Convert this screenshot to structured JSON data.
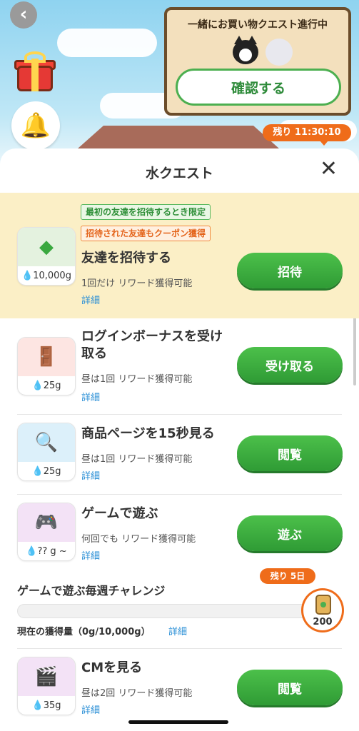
{
  "header": {
    "back_glyph": "‹",
    "signboard_title": "一緒にお買い物クエスト進行中",
    "confirm_label": "確認する",
    "timer": "残り 11:30:10"
  },
  "sheet": {
    "title": "水クエスト",
    "close_glyph": "✕"
  },
  "quests": [
    {
      "title": "友達を招待する",
      "sub": "1回だけ リワード獲得可能",
      "detail": "詳細",
      "reward": "10,000g",
      "button": "招待",
      "icon": "beginner-mark-icon",
      "tags": [
        "最初の友達を招待するとき限定",
        "招待された友達もクーポン獲得"
      ]
    },
    {
      "title": "ログインボーナスを受け取る",
      "sub": "昼は1回 リワード獲得可能",
      "detail": "詳細",
      "reward": "25g",
      "button": "受け取る",
      "icon": "door-icon"
    },
    {
      "title": "商品ページを15秒見る",
      "sub": "昼は1回 リワード獲得可能",
      "detail": "詳細",
      "reward": "25g",
      "button": "閲覧",
      "icon": "search-icon"
    },
    {
      "title": "ゲームで遊ぶ",
      "sub": "何回でも リワード獲得可能",
      "detail": "詳細",
      "reward": "?? g ~",
      "button": "遊ぶ",
      "icon": "gamepad-icon"
    },
    {
      "title": "CMを見る",
      "sub": "昼は2回 リワード獲得可能",
      "detail": "詳細",
      "reward": "35g",
      "button": "閲覧",
      "icon": "clapperboard-icon"
    }
  ],
  "challenge": {
    "title": "ゲームで遊ぶ毎週チャレンジ",
    "remaining": "残り 5日",
    "progress_label": "現在の獲得量（0g/10,000g）",
    "progress_fraction": 0,
    "detail": "詳細",
    "reward_amount": "200"
  },
  "colors": {
    "accent_green": "#3aa83f",
    "accent_orange": "#ef6c1a",
    "link_blue": "#2a8fd6",
    "highlight": "#fbefc6"
  }
}
